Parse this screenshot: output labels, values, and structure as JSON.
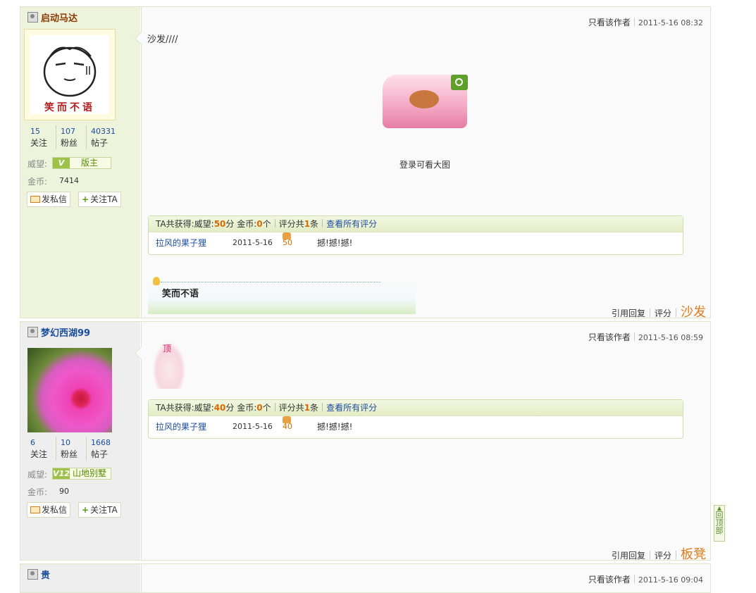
{
  "posts": [
    {
      "author": "启动马达",
      "stats": [
        {
          "n": "15",
          "l": "关注"
        },
        {
          "n": "107",
          "l": "粉丝"
        },
        {
          "n": "40331",
          "l": "帖子"
        }
      ],
      "prestige_label": "威望:",
      "badge_level": "V",
      "badge_text": "版主",
      "coins_label": "金币:",
      "coins": "7414",
      "pm_label": "发私信",
      "follow_label": "关注TA",
      "only_author": "只看该作者",
      "time": "2011-5-16 08:32",
      "content": "沙发////",
      "avatar_caption": "笑而不语",
      "login_tip": "登录可看大图",
      "rating": {
        "prefix": "TA共获得:",
        "prestige_label": "威望:",
        "prestige": "50",
        "prestige_unit": "分",
        "coin_label": "金币:",
        "coin": "0",
        "coin_unit": "个",
        "count_prefix": "评分共",
        "count": "1",
        "count_unit": "条",
        "view_all": "查看所有评分",
        "user": "拉风的果子狸",
        "date": "2011-5-16",
        "score": "50",
        "comment": "撼!撼!撼!"
      },
      "signature": "笑而不语",
      "reply": "引用回复",
      "rate": "评分",
      "floor": "沙发"
    },
    {
      "author": "梦幻西湖99",
      "stats": [
        {
          "n": "6",
          "l": "关注"
        },
        {
          "n": "10",
          "l": "粉丝"
        },
        {
          "n": "1668",
          "l": "帖子"
        }
      ],
      "prestige_label": "威望:",
      "badge_level": "V12",
      "badge_text": "山地别墅",
      "coins_label": "金币:",
      "coins": "90",
      "pm_label": "发私信",
      "follow_label": "关注TA",
      "only_author": "只看该作者",
      "time": "2011-5-16 08:59",
      "emoticon_tag": "顶",
      "rating": {
        "prefix": "TA共获得:",
        "prestige_label": "威望:",
        "prestige": "40",
        "prestige_unit": "分",
        "coin_label": "金币:",
        "coin": "0",
        "coin_unit": "个",
        "count_prefix": "评分共",
        "count": "1",
        "count_unit": "条",
        "view_all": "查看所有评分",
        "user": "拉风的果子狸",
        "date": "2011-5-16",
        "score": "40",
        "comment": "撼!撼!撼!"
      },
      "reply": "引用回复",
      "rate": "评分",
      "floor": "板凳"
    },
    {
      "author": "贵",
      "only_author": "只看该作者",
      "time": "2011-5-16 09:04"
    }
  ],
  "gotop": "回顶部"
}
